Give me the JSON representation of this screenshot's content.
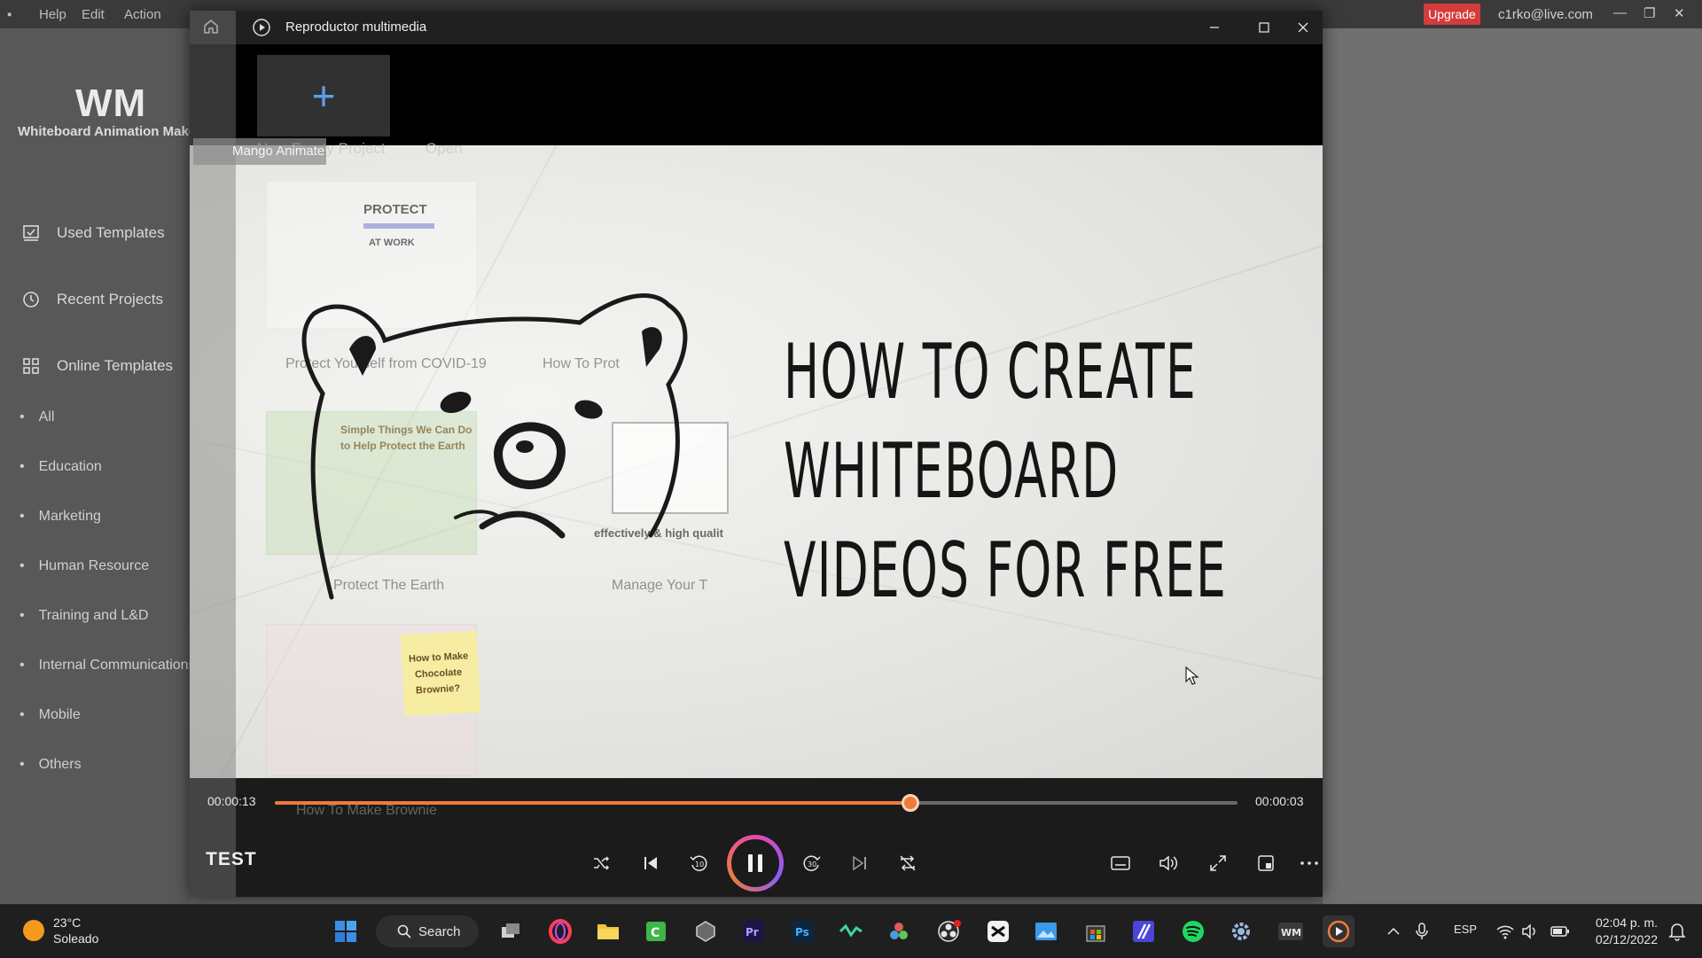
{
  "background_app": {
    "menu": [
      "Help",
      "Edit",
      "Action"
    ],
    "upgrade_label": "Upgrade",
    "account": "c1rko@live.com",
    "logo": "WM",
    "logo_subtitle": "Whiteboard Animation Maker",
    "sidebar": {
      "items": [
        {
          "label": "Used Templates",
          "icon": "template-icon"
        },
        {
          "label": "Recent Projects",
          "icon": "clock-icon"
        },
        {
          "label": "Online Templates",
          "icon": "grid-icon"
        }
      ],
      "categories": [
        "All",
        "Education",
        "Marketing",
        "Human Resource",
        "Training and L&D",
        "Internal Communications",
        "Mobile",
        "Others"
      ]
    },
    "new_project_label": "New Empty Project",
    "open_label": "Open",
    "mango_badge": "Mango Animate",
    "template_cards": [
      "Protect Yourself from COVID-19",
      "How To Prot",
      "Protect The Earth",
      "Manage Your T",
      "How To Make Brownie"
    ],
    "card_texts": {
      "protect": "PROTECT",
      "at_work": "AT WORK",
      "simple_things": "Simple Things We Can Do",
      "protect_earth_line": "to Help Protect the Earth",
      "effectively": "effectively & high qualit",
      "brownie_note_1": "How to Make",
      "brownie_note_2": "Chocolate",
      "brownie_note_3": "Brownie?"
    }
  },
  "player": {
    "window_title": "Reproductor multimedia",
    "video_headline": [
      "HOW TO CREATE",
      "WHITEBOARD",
      "VIDEOS FOR FREE"
    ],
    "time_elapsed": "00:00:13",
    "time_remaining": "00:00:03",
    "progress": 0.66,
    "media_title": "TEST",
    "accent": "#f07a3a"
  },
  "taskbar": {
    "weather_temp": "23°C",
    "weather_desc": "Soleado",
    "search_label": "Search",
    "language": "ESP",
    "time": "02:04 p. m.",
    "date": "02/12/2022"
  }
}
